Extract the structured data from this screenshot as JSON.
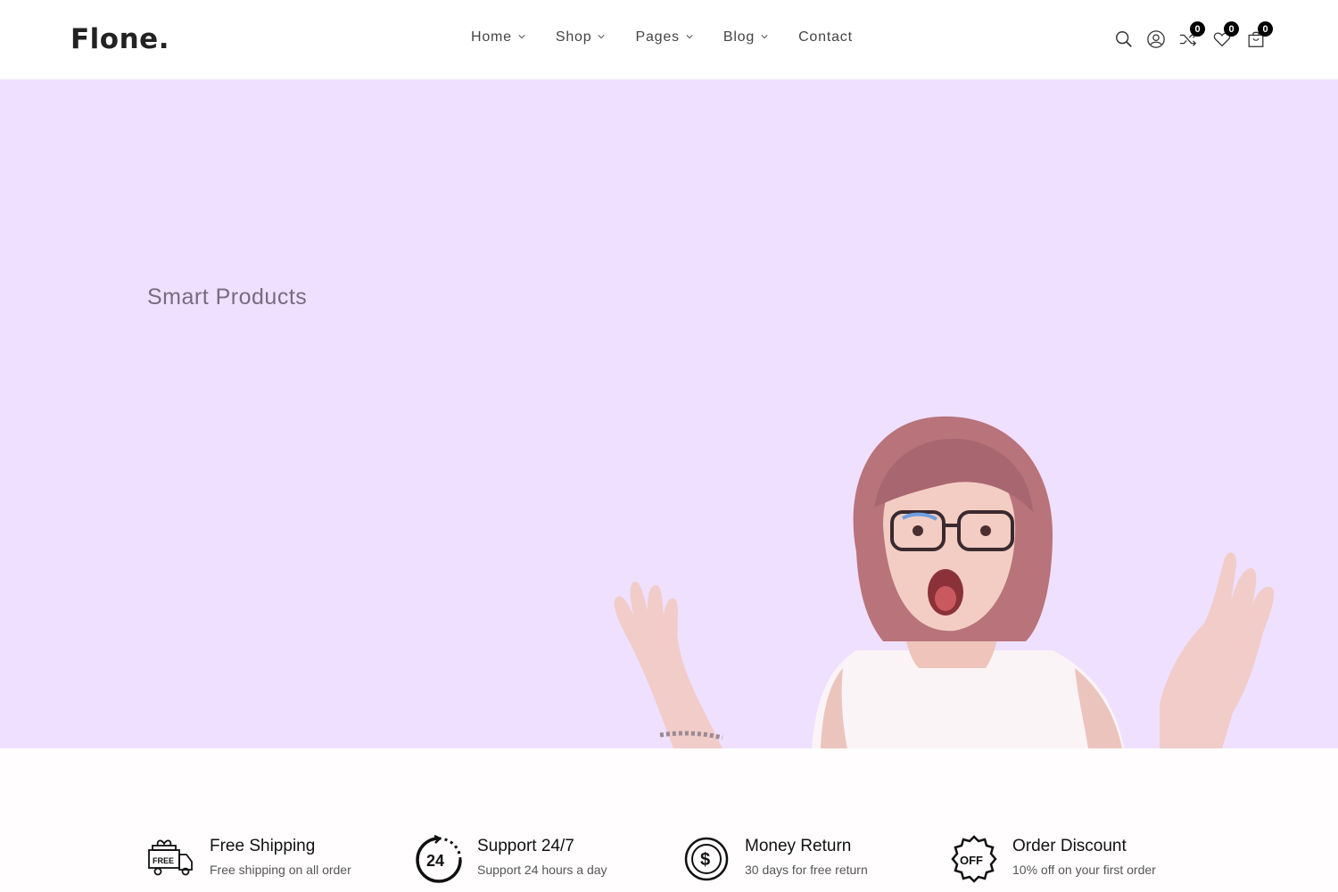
{
  "brand": {
    "logo_text": "Flone."
  },
  "nav": {
    "items": [
      {
        "label": "Home",
        "has_dropdown": true
      },
      {
        "label": "Shop",
        "has_dropdown": true
      },
      {
        "label": "Pages",
        "has_dropdown": true
      },
      {
        "label": "Blog",
        "has_dropdown": true
      },
      {
        "label": "Contact",
        "has_dropdown": false
      }
    ]
  },
  "header_icons": {
    "search": "search-icon",
    "account": "user-icon",
    "compare": {
      "icon": "shuffle-icon",
      "count": "0"
    },
    "wishlist": {
      "icon": "heart-icon",
      "count": "0"
    },
    "cart": {
      "icon": "shopping-bag-icon",
      "count": "0"
    }
  },
  "hero": {
    "title": "Smart Products",
    "background_color": "#efe0ff"
  },
  "features": [
    {
      "icon": "free-shipping-truck-icon",
      "title": "Free Shipping",
      "description": "Free shipping on all order"
    },
    {
      "icon": "support-24-icon",
      "title": "Support 24/7",
      "description": "Support 24 hours a day"
    },
    {
      "icon": "money-return-icon",
      "title": "Money Return",
      "description": "30 days for free return"
    },
    {
      "icon": "discount-off-badge-icon",
      "title": "Order Discount",
      "description": "10% off on your first order"
    }
  ]
}
